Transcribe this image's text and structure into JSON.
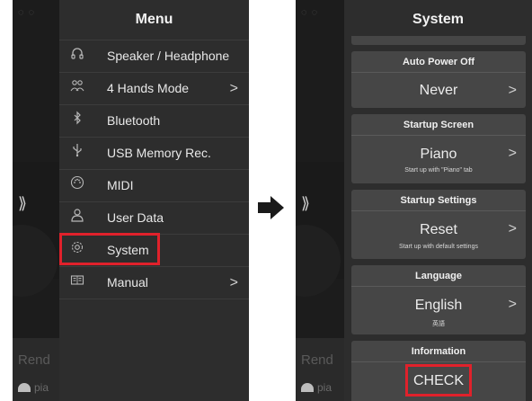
{
  "left_screen": {
    "menu_title": "Menu",
    "items": [
      {
        "icon": "headphone-icon",
        "label": "Speaker / Headphone",
        "chevron": ""
      },
      {
        "icon": "four-hands-icon",
        "label": "4 Hands Mode",
        "chevron": ">"
      },
      {
        "icon": "bluetooth-icon",
        "label": "Bluetooth",
        "chevron": ""
      },
      {
        "icon": "usb-icon",
        "label": "USB Memory Rec.",
        "chevron": ""
      },
      {
        "icon": "midi-icon",
        "label": "MIDI",
        "chevron": ""
      },
      {
        "icon": "user-icon",
        "label": "User Data",
        "chevron": ""
      },
      {
        "icon": "gear-icon",
        "label": "System",
        "chevron": "",
        "highlighted": true
      },
      {
        "icon": "book-icon",
        "label": "Manual",
        "chevron": ">"
      }
    ],
    "background": {
      "partial_text": "Rend",
      "piano_text": "pia",
      "arrows": "⟫"
    }
  },
  "right_screen": {
    "title": "System",
    "cards": [
      {
        "header": "Auto Power Off",
        "value": "Never",
        "note": "",
        "chevron": ">"
      },
      {
        "header": "Startup Screen",
        "value": "Piano",
        "note": "Start up with \"Piano\" tab",
        "chevron": ">"
      },
      {
        "header": "Startup Settings",
        "value": "Reset",
        "note": "Start up with default settings",
        "chevron": ">"
      },
      {
        "header": "Language",
        "value": "English",
        "note": "英語",
        "chevron": ">"
      },
      {
        "header": "Information",
        "value": "CHECK",
        "note": "",
        "chevron": "",
        "highlighted": true
      }
    ],
    "background": {
      "partial_text": "Rend",
      "piano_text": "pia",
      "arrows": "⟫"
    }
  },
  "colors": {
    "highlight": "#e0212b",
    "panel": "#2d2d2d",
    "card": "#464646",
    "arrow": "#1a1a1a"
  }
}
